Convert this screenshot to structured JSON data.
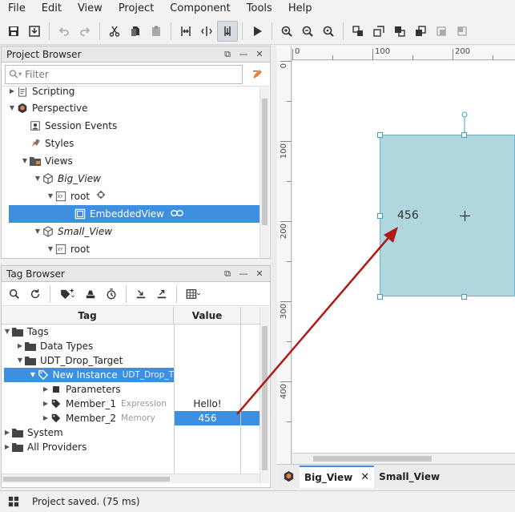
{
  "menu": [
    "File",
    "Edit",
    "View",
    "Project",
    "Component",
    "Tools",
    "Help"
  ],
  "project_browser": {
    "title": "Project Browser",
    "filter_placeholder": "Filter",
    "items": [
      {
        "label": "Scripting"
      },
      {
        "label": "Perspective"
      },
      {
        "label": "Session Events"
      },
      {
        "label": "Styles"
      },
      {
        "label": "Views"
      },
      {
        "label": "Big_View"
      },
      {
        "label": "root"
      },
      {
        "label": "EmbeddedView"
      },
      {
        "label": "Small_View"
      },
      {
        "label": "root"
      }
    ]
  },
  "tag_browser": {
    "title": "Tag Browser",
    "col_tag": "Tag",
    "col_value": "Value",
    "items": [
      {
        "label": "Tags"
      },
      {
        "label": "Data Types"
      },
      {
        "label": "UDT_Drop_Target"
      },
      {
        "label": "New Instance",
        "sub": "UDT_Drop_T"
      },
      {
        "label": "Parameters"
      },
      {
        "label": "Member_1",
        "sub": "Expression"
      },
      {
        "label": "Member_2",
        "sub": "Memory"
      },
      {
        "label": "System"
      },
      {
        "label": "All Providers"
      }
    ],
    "values": {
      "member1": "Hello!",
      "member2": "456"
    }
  },
  "canvas": {
    "ruler_top": [
      "0",
      "100",
      "200"
    ],
    "ruler_left": [
      "0",
      "100",
      "200",
      "300",
      "400"
    ],
    "embedded_value": "456"
  },
  "tabs": [
    {
      "label": "Big_View"
    },
    {
      "label": "Small_View"
    }
  ],
  "status": "Project saved. (75 ms)",
  "colors": {
    "selection": "#3d8fe0",
    "component_fill": "#b0d6de",
    "arrow": "#b01818"
  }
}
